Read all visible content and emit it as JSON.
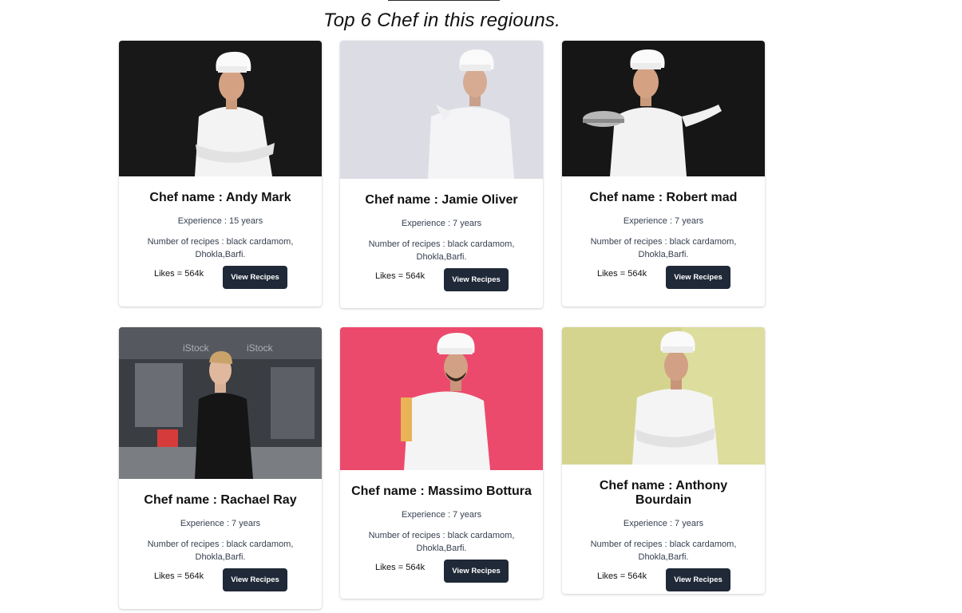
{
  "page": {
    "heading": "Top 6 Chef in this regiouns."
  },
  "cards": [
    {
      "name": "Chef name : Andy Mark",
      "experience": "Experience : 15 years",
      "recipes": "Number of recipes : black cardamom, Dhokla,Barfi.",
      "likes": "Likes = 564k",
      "button": "View Recipes",
      "photo_bg": "#141414"
    },
    {
      "name": "Chef name : Jamie Oliver",
      "experience": "Experience : 7 years",
      "recipes": "Number of recipes : black cardamom, Dhokla,Barfi.",
      "likes": "Likes = 564k",
      "button": "View Recipes",
      "photo_bg": "#dcdce4"
    },
    {
      "name": "Chef name : Robert mad",
      "experience": "Experience : 7 years",
      "recipes": "Number of recipes : black cardamom, Dhokla,Barfi.",
      "likes": "Likes = 564k",
      "button": "View Recipes",
      "photo_bg": "#161616"
    },
    {
      "name": "Chef name : Rachael Ray",
      "experience": "Experience : 7 years",
      "recipes": "Number of recipes : black cardamom, Dhokla,Barfi.",
      "likes": "Likes = 564k",
      "button": "View Recipes",
      "photo_bg": "#3a3d42"
    },
    {
      "name": "Chef name : Massimo Bottura",
      "experience": "Experience : 7 years",
      "recipes": "Number of recipes : black cardamom, Dhokla,Barfi.",
      "likes": "Likes = 564k",
      "button": "View Recipes",
      "photo_bg": "#ec4a6c"
    },
    {
      "name": "Chef name : Anthony Bourdain",
      "experience": "Experience : 7 years",
      "recipes": "Number of recipes : black cardamom, Dhokla,Barfi.",
      "likes": "Likes = 564k",
      "button": "View Recipes",
      "photo_bg": "#d4d48e"
    }
  ]
}
